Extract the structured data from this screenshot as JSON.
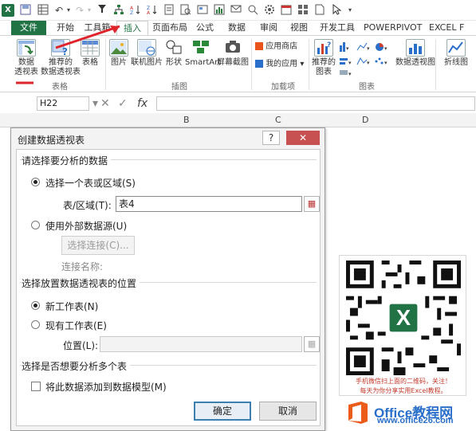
{
  "colors": {
    "excel_green": "#217346",
    "annotation_red": "#e0242b",
    "office_orange": "#eb5c1a",
    "watermark_blue": "#2a6fc9",
    "dialog_close": "#c75050"
  },
  "tabs": [
    "文件",
    "开始",
    "工具箱",
    "插入",
    "页面布局",
    "公式",
    "数据",
    "审阅",
    "视图",
    "开发工具",
    "POWERPIVOT",
    "EXCEL F"
  ],
  "active_tab": "插入",
  "ribbon": {
    "pivot_label_1": "数据",
    "pivot_label_2": "透视表",
    "rec_pivot_1": "推荐的",
    "rec_pivot_2": "数据透视表",
    "table": "表格",
    "group_table": "表格",
    "pictures": "图片",
    "online_pictures": "联机图片",
    "shapes": "形状",
    "smartart": "SmartArt",
    "screenshot": "屏幕截图",
    "group_illustrations": "插图",
    "app_store": "应用商店",
    "my_apps": "我的应用",
    "group_addins": "加载项",
    "rec_charts_1": "推荐的",
    "rec_charts_2": "图表",
    "group_charts": "图表",
    "pivot_chart": "数据透视图",
    "line_chart": "折线图"
  },
  "formula_bar": {
    "name_box": "H22",
    "fx": "fx",
    "columns": [
      "B",
      "C",
      "D"
    ]
  },
  "dialog": {
    "title": "创建数据透视表",
    "help": "?",
    "close": "✕",
    "section1": "请选择要分析的数据",
    "opt_select_table": "选择一个表或区域(S)",
    "table_range_label": "表/区域(T):",
    "table_range_value": "表4",
    "opt_external": "使用外部数据源(U)",
    "choose_connection": "选择连接(C)...",
    "connection_name_label": "连接名称:",
    "section2": "选择放置数据透视表的位置",
    "opt_new_sheet": "新工作表(N)",
    "opt_existing_sheet": "现有工作表(E)",
    "location_label": "位置(L):",
    "location_value": "",
    "section3": "选择是否想要分析多个表",
    "add_to_model": "将此数据添加到数据模型(M)",
    "add_to_model_checked": false,
    "ok": "确定",
    "cancel": "取消"
  },
  "qr_card": {
    "caption1": "手机微信扫上面的二维码，关注！",
    "caption2": "每天为你分享实用Excel教程。"
  },
  "watermark": {
    "text": "Office教程网",
    "sub": "www.office26.com"
  }
}
